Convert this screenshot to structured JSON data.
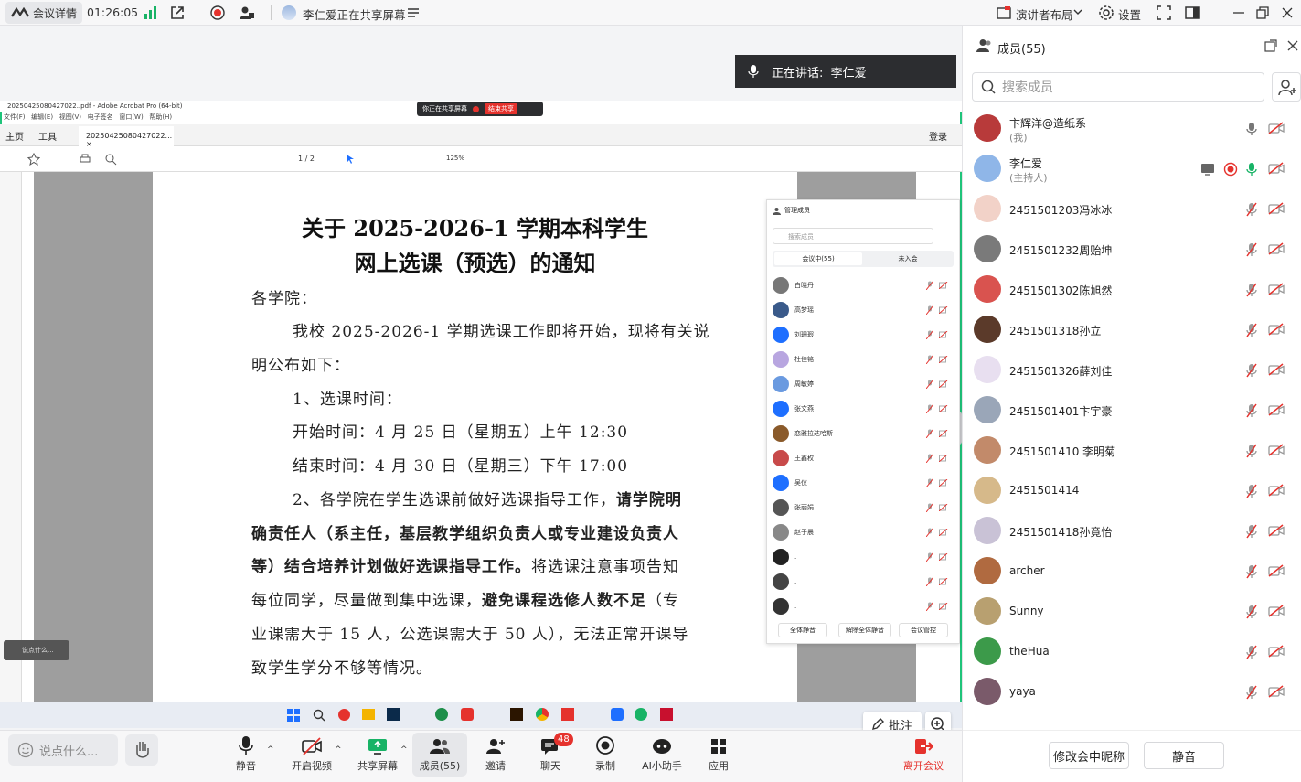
{
  "topbar": {
    "meeting_info": "会议详情",
    "time": "01:26:05",
    "sharing_status": "李仁爱正在共享屏幕",
    "layout": "演讲者布局",
    "settings": "设置"
  },
  "speaker": {
    "label": "正在讲话:",
    "name": "李仁爱"
  },
  "shared_screen": {
    "window_title": "20250425080427022..pdf - Adobe Acrobat Pro (64-bit)",
    "share_notice": "你正在共享屏幕",
    "stop_share": "结束共享",
    "tabs": {
      "home": "主页",
      "tools": "工具",
      "file_tab": "20250425080427022...",
      "login": "登录"
    },
    "page_indicator": "1 / 2",
    "zoom": "125%",
    "document": {
      "title_line1": "关于 2025-2026-1 学期本科学生",
      "title_line2": "网上选课（预选）的通知",
      "lines": [
        "各学院：",
        "我校 2025-2026-1 学期选课工作即将开始，现将有关说",
        "明公布如下：",
        "1、选课时间：",
        "开始时间：4 月 25 日（星期五）上午 12:30",
        "结束时间：4 月 30 日（星期三）下午 17:00"
      ],
      "para2_a": "2、各学院在学生选课前做好选课指导工作，",
      "para2_b": "请学院明",
      "para2_c": "确责任人（系主任，基层教学组织负责人或专业建设负责人",
      "para2_d": "等）结合培养计划做好选课指导工作。",
      "para2_e": "将选课注意事项告知",
      "para2_f": "每位同学，尽量做到集中选课，",
      "para2_g": "避免课程选修人数不足",
      "para2_h": "（专",
      "para2_i": "业课需大于 15 人，公选课需大于 50 人），无法正常开课导",
      "para2_j": "致学生学分不够等情况。"
    },
    "mini_panel": {
      "title": "管理成员",
      "search": "搜索成员",
      "tab_in": "会议中(55)",
      "tab_out": "未入会",
      "names": [
        "白晓丹",
        "高梦瑶",
        "刘珊瑕",
        "杜佳铭",
        "周敏婷",
        "张文燕",
        "恋雅拉达哈斯",
        "王鑫权",
        "吴仪",
        "张丽娟",
        "赵子晨",
        ".",
        ".",
        "."
      ],
      "btn_mute_all": "全体静音",
      "btn_unmute_all": "解除全体静音",
      "btn_manage": "会议管控"
    },
    "chat_hint": "说点什么...",
    "annotate": "批注"
  },
  "bottombar": {
    "chat_placeholder": "说点什么...",
    "mute": "静音",
    "video": "开启视频",
    "share": "共享屏幕",
    "members": "成员(55)",
    "invite": "邀请",
    "chat": "聊天",
    "chat_badge": "48",
    "record": "录制",
    "ai": "AI小助手",
    "apps": "应用",
    "leave": "离开会议"
  },
  "panel": {
    "title": "成员(55)",
    "search_placeholder": "搜索成员",
    "members": [
      {
        "name": "卞辉洋@造纸系",
        "sub": "(我)"
      },
      {
        "name": "李仁爱",
        "sub": "(主持人)"
      },
      {
        "name": "2451501203冯冰冰"
      },
      {
        "name": "2451501232周贻坤"
      },
      {
        "name": "2451501302陈旭然"
      },
      {
        "name": "2451501318孙立"
      },
      {
        "name": "2451501326薛刘佳"
      },
      {
        "name": "2451501401卞宇豪"
      },
      {
        "name": "2451501410 李明菊"
      },
      {
        "name": "2451501414"
      },
      {
        "name": "2451501418孙竟怡"
      },
      {
        "name": "archer"
      },
      {
        "name": "Sunny"
      },
      {
        "name": "theHua"
      },
      {
        "name": "yaya"
      }
    ],
    "rename_button": "修改会中昵称",
    "mute_button": "静音"
  },
  "colors": {
    "accent": "#1e6fff",
    "green": "#18b366",
    "red": "#e5322d",
    "share_border": "#1fc47a"
  }
}
